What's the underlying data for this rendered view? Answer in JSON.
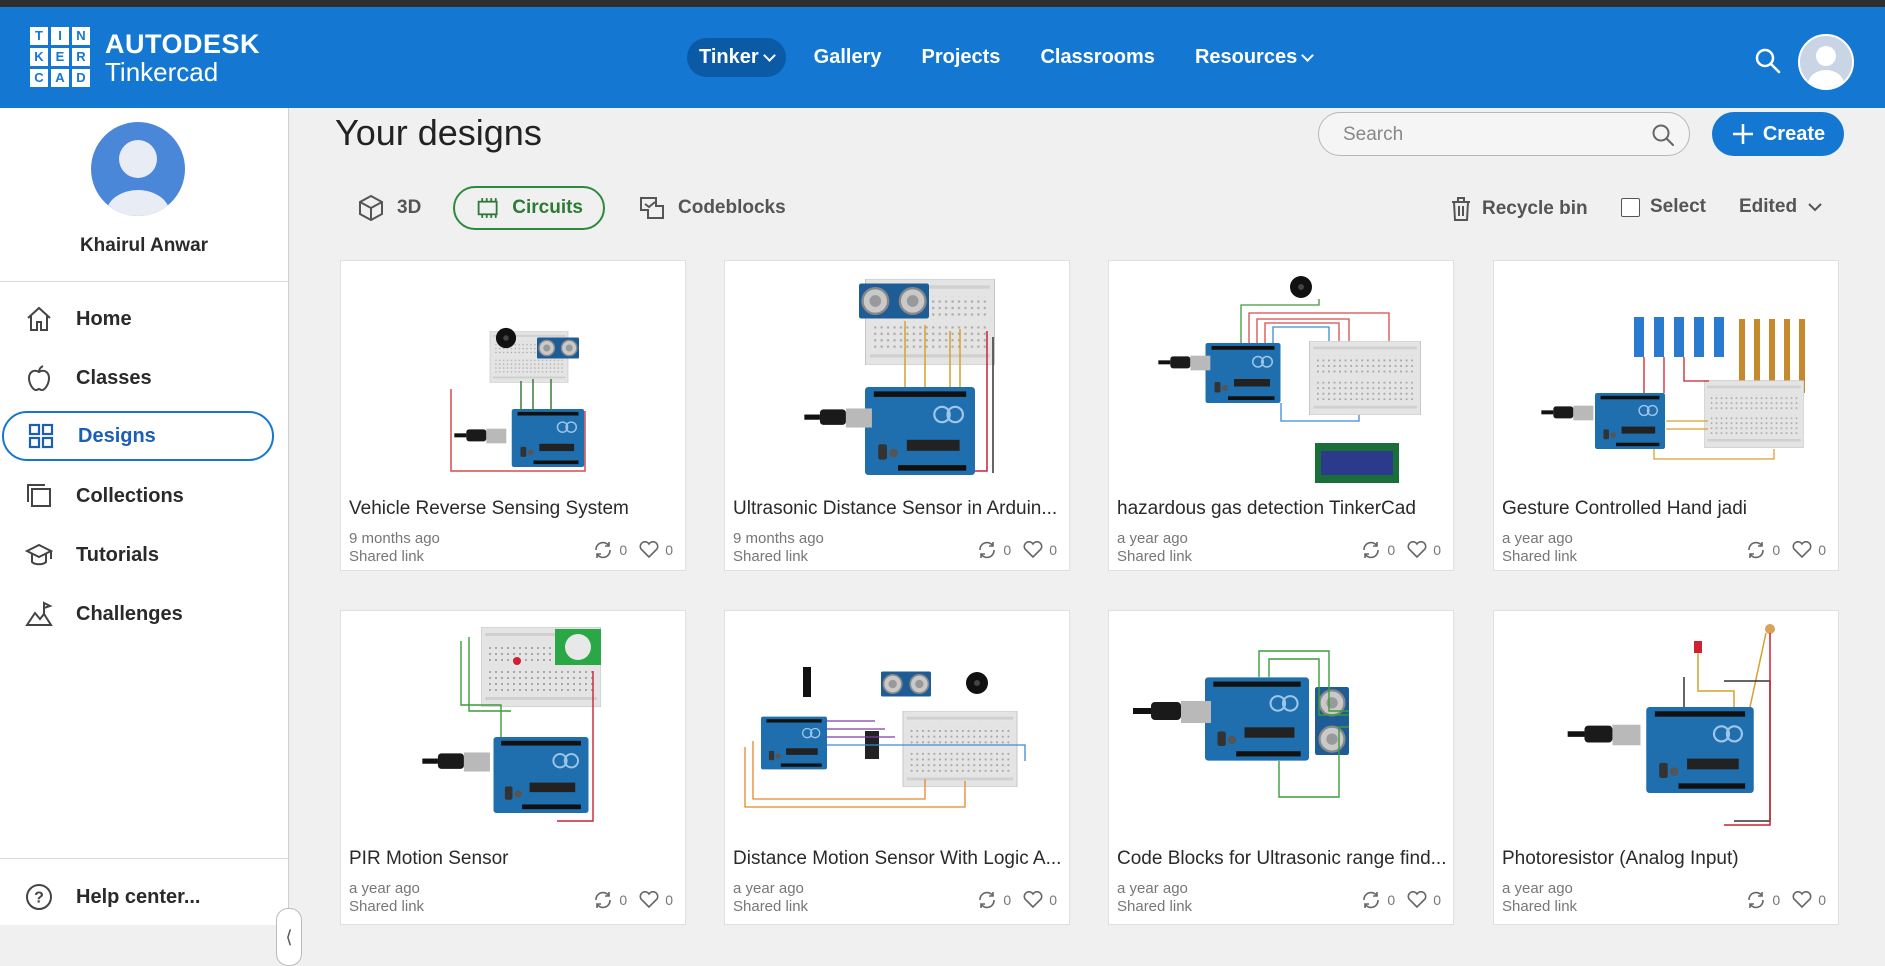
{
  "brand": {
    "logo_letters": [
      "T",
      "I",
      "N",
      "K",
      "E",
      "R",
      "C",
      "A",
      "D"
    ],
    "line1": "AUTODESK",
    "line2": "Tinkercad"
  },
  "nav": {
    "tinker": "Tinker",
    "gallery": "Gallery",
    "projects": "Projects",
    "classrooms": "Classrooms",
    "resources": "Resources"
  },
  "user": {
    "name": "Khairul Anwar"
  },
  "sidebar": {
    "items": [
      {
        "label": "Home",
        "icon": "home-icon"
      },
      {
        "label": "Classes",
        "icon": "apple-icon"
      },
      {
        "label": "Designs",
        "icon": "grid-icon",
        "active": true
      },
      {
        "label": "Collections",
        "icon": "collections-icon"
      },
      {
        "label": "Tutorials",
        "icon": "graduation-cap-icon"
      },
      {
        "label": "Challenges",
        "icon": "mountain-flag-icon"
      }
    ],
    "help": "Help center..."
  },
  "main": {
    "title": "Your designs",
    "search_placeholder": "Search",
    "create_label": "Create",
    "tabs": [
      {
        "label": "3D"
      },
      {
        "label": "Circuits",
        "active": true
      },
      {
        "label": "Codeblocks"
      }
    ],
    "recycle_label": "Recycle bin",
    "select_label": "Select",
    "sort_label": "Edited"
  },
  "designs": [
    {
      "title": "Vehicle Reverse Sensing System",
      "time": "9 months ago",
      "share": "Shared link",
      "remixes": "0",
      "likes": "0"
    },
    {
      "title": "Ultrasonic Distance Sensor in Arduin...",
      "time": "9 months ago",
      "share": "Shared link",
      "remixes": "0",
      "likes": "0"
    },
    {
      "title": "hazardous gas detection TinkerCad",
      "time": "a year ago",
      "share": "Shared link",
      "remixes": "0",
      "likes": "0"
    },
    {
      "title": "Gesture Controlled Hand jadi",
      "time": "a year ago",
      "share": "Shared link",
      "remixes": "0",
      "likes": "0"
    },
    {
      "title": "PIR Motion Sensor",
      "time": "a year ago",
      "share": "Shared link",
      "remixes": "0",
      "likes": "0"
    },
    {
      "title": "Distance Motion Sensor With Logic A...",
      "time": "a year ago",
      "share": "Shared link",
      "remixes": "0",
      "likes": "0"
    },
    {
      "title": "Code Blocks for Ultrasonic range find...",
      "time": "a year ago",
      "share": "Shared link",
      "remixes": "0",
      "likes": "0"
    },
    {
      "title": "Photoresistor (Analog Input)",
      "time": "a year ago",
      "share": "Shared link",
      "remixes": "0",
      "likes": "0"
    }
  ],
  "colors": {
    "topbar": "#1477d1",
    "accent_green": "#2d8a3d",
    "arduino_blue": "#1f6fae"
  }
}
